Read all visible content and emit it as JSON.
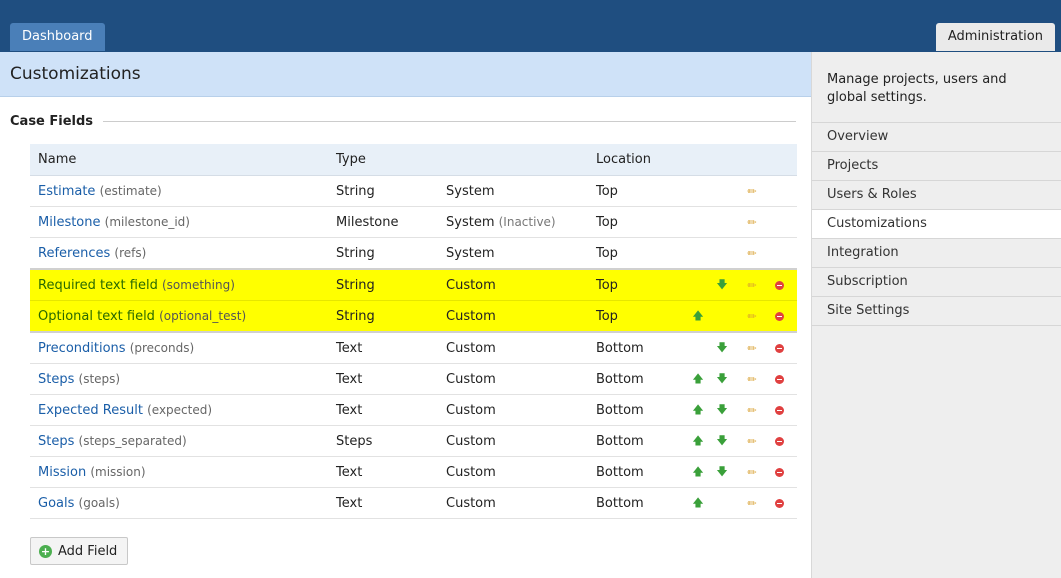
{
  "tabs": {
    "dashboard": "Dashboard",
    "administration": "Administration"
  },
  "page": {
    "title": "Customizations",
    "section": "Case Fields"
  },
  "table": {
    "headers": {
      "name": "Name",
      "type": "Type",
      "location": "Location"
    },
    "rows": [
      {
        "name": "Estimate",
        "key": "(estimate)",
        "type": "String",
        "origin": "System",
        "note": "",
        "location": "Top",
        "up": false,
        "down": false,
        "del": false
      },
      {
        "name": "Milestone",
        "key": "(milestone_id)",
        "type": "Milestone",
        "origin": "System",
        "note": "(Inactive)",
        "location": "Top",
        "up": false,
        "down": false,
        "del": false
      },
      {
        "name": "References",
        "key": "(refs)",
        "type": "String",
        "origin": "System",
        "note": "",
        "location": "Top",
        "up": false,
        "down": false,
        "del": false
      },
      {
        "name": "Required text field",
        "key": "(something)",
        "type": "String",
        "origin": "Custom",
        "note": "",
        "location": "Top",
        "up": false,
        "down": true,
        "del": true
      },
      {
        "name": "Optional text field",
        "key": "(optional_test)",
        "type": "String",
        "origin": "Custom",
        "note": "",
        "location": "Top",
        "up": true,
        "down": false,
        "del": true
      },
      {
        "name": "Preconditions",
        "key": "(preconds)",
        "type": "Text",
        "origin": "Custom",
        "note": "",
        "location": "Bottom",
        "up": false,
        "down": true,
        "del": true
      },
      {
        "name": "Steps",
        "key": "(steps)",
        "type": "Text",
        "origin": "Custom",
        "note": "",
        "location": "Bottom",
        "up": true,
        "down": true,
        "del": true
      },
      {
        "name": "Expected Result",
        "key": "(expected)",
        "type": "Text",
        "origin": "Custom",
        "note": "",
        "location": "Bottom",
        "up": true,
        "down": true,
        "del": true
      },
      {
        "name": "Steps",
        "key": "(steps_separated)",
        "type": "Steps",
        "origin": "Custom",
        "note": "",
        "location": "Bottom",
        "up": true,
        "down": true,
        "del": true
      },
      {
        "name": "Mission",
        "key": "(mission)",
        "type": "Text",
        "origin": "Custom",
        "note": "",
        "location": "Bottom",
        "up": true,
        "down": true,
        "del": true
      },
      {
        "name": "Goals",
        "key": "(goals)",
        "type": "Text",
        "origin": "Custom",
        "note": "",
        "location": "Bottom",
        "up": true,
        "down": false,
        "del": true
      }
    ]
  },
  "add_button": "Add Field",
  "sidebar": {
    "description": "Manage projects, users and global settings.",
    "items": [
      "Overview",
      "Projects",
      "Users & Roles",
      "Customizations",
      "Integration",
      "Subscription",
      "Site Settings"
    ]
  }
}
